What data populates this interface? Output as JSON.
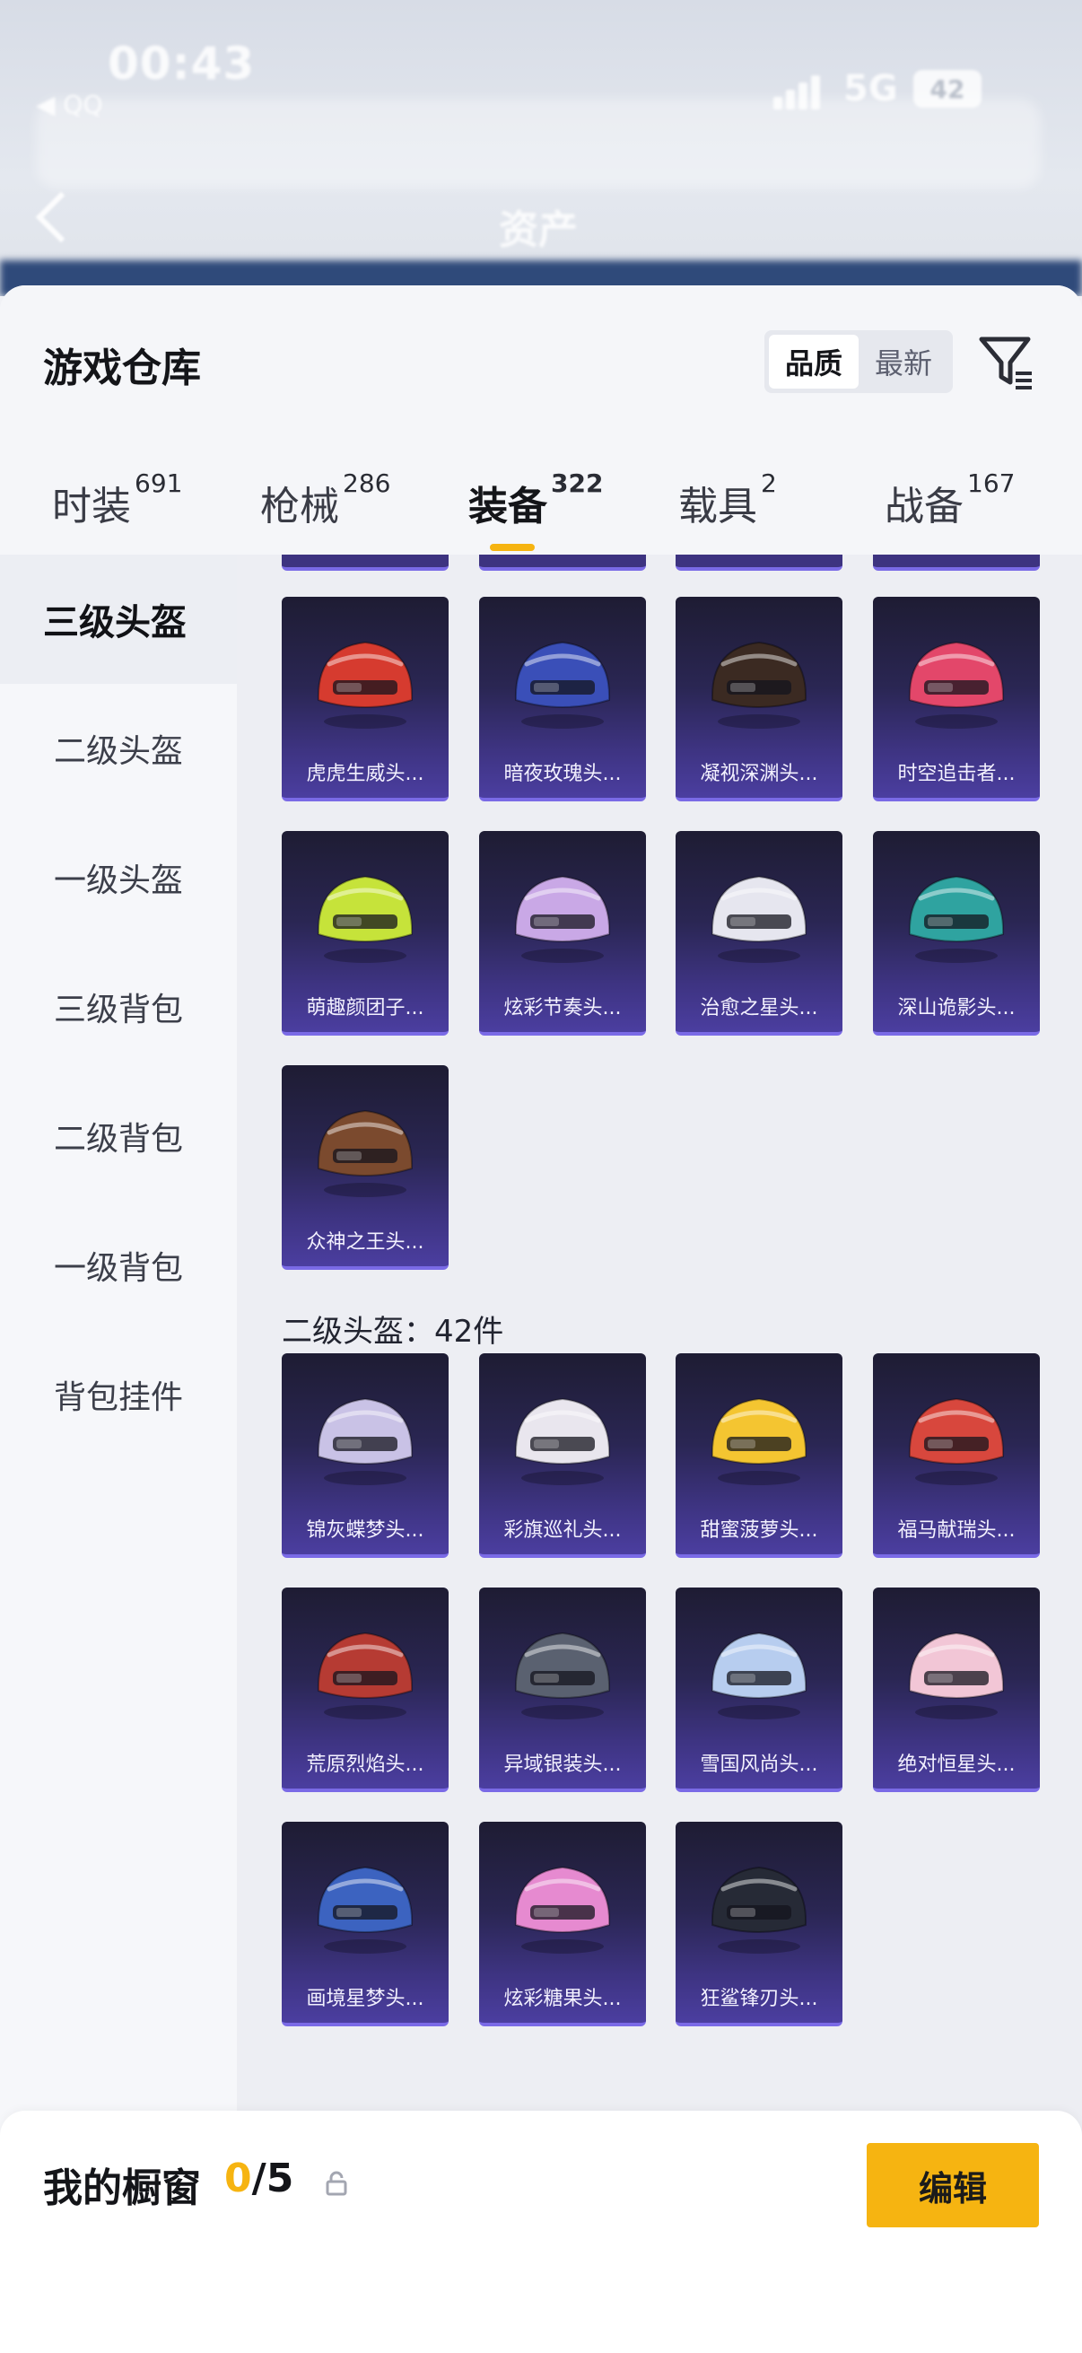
{
  "status": {
    "time": "00:43",
    "back_app": "◀ QQ",
    "network": "5G",
    "battery": "42"
  },
  "background": {
    "title": "资产"
  },
  "header": {
    "title": "游戏仓库",
    "sort_options": [
      "品质",
      "最新"
    ],
    "sort_selected": "品质"
  },
  "tabs": [
    {
      "label": "时装",
      "count": "691"
    },
    {
      "label": "枪械",
      "count": "286"
    },
    {
      "label": "装备",
      "count": "322",
      "active": true
    },
    {
      "label": "载具",
      "count": "2"
    },
    {
      "label": "战备",
      "count": "167"
    }
  ],
  "sidebar": {
    "items": [
      {
        "label": "三级头盔",
        "active": true
      },
      {
        "label": "二级头盔"
      },
      {
        "label": "一级头盔"
      },
      {
        "label": "三级背包"
      },
      {
        "label": "二级背包"
      },
      {
        "label": "一级背包"
      },
      {
        "label": "背包挂件"
      }
    ]
  },
  "level3_items": [
    {
      "name": "虎虎生威头...",
      "icon": "helmet-tiger-icon",
      "color": "#d63b2f"
    },
    {
      "name": "暗夜玫瑰头...",
      "icon": "helmet-rose-icon",
      "color": "#3a4fb8"
    },
    {
      "name": "凝视深渊头...",
      "icon": "helmet-abyss-icon",
      "color": "#3b2a22"
    },
    {
      "name": "时空追击者...",
      "icon": "helmet-mech-icon",
      "color": "#e3476a"
    },
    {
      "name": "萌趣颜团子...",
      "icon": "helmet-sprout-icon",
      "color": "#c6e33a"
    },
    {
      "name": "炫彩节奏头...",
      "icon": "helmet-rhythm-icon",
      "color": "#c9a8e6"
    },
    {
      "name": "治愈之星头...",
      "icon": "helmet-star-icon",
      "color": "#e6e6ef"
    },
    {
      "name": "深山诡影头...",
      "icon": "helmet-shadow-icon",
      "color": "#2fa3a0"
    },
    {
      "name": "众神之王头...",
      "icon": "helmet-god-icon",
      "color": "#7b4a2e"
    }
  ],
  "level2_section": {
    "title": "二级头盔：42件"
  },
  "level2_items": [
    {
      "name": "锦灰蝶梦头...",
      "icon": "helmet-butterfly-icon",
      "color": "#c9c2e6"
    },
    {
      "name": "彩旗巡礼头...",
      "icon": "helmet-flag-icon",
      "color": "#e9e6ee"
    },
    {
      "name": "甜蜜菠萝头...",
      "icon": "helmet-pineapple-icon",
      "color": "#f4c531"
    },
    {
      "name": "福马献瑞头...",
      "icon": "helmet-horse-icon",
      "color": "#d8473d"
    },
    {
      "name": "荒原烈焰头...",
      "icon": "helmet-flame-icon",
      "color": "#b63b33"
    },
    {
      "name": "异域银装头...",
      "icon": "helmet-silver-icon",
      "color": "#5a6170"
    },
    {
      "name": "雪国风尚头...",
      "icon": "helmet-snow-icon",
      "color": "#b7cdef"
    },
    {
      "name": "绝对恒星头...",
      "icon": "helmet-pink-icon",
      "color": "#f2c6d6"
    },
    {
      "name": "画境星梦头...",
      "icon": "helmet-galaxy-icon",
      "color": "#3c63c0"
    },
    {
      "name": "炫彩糖果头...",
      "icon": "helmet-candy-icon",
      "color": "#e68ad0"
    },
    {
      "name": "狂鲨锋刃头...",
      "icon": "helmet-shark-icon",
      "color": "#262a36"
    }
  ],
  "bottom": {
    "showcase_label": "我的橱窗",
    "showcase_current": "0",
    "showcase_total": "/5",
    "edit_label": "编辑"
  },
  "colors": {
    "accent": "#f6b411",
    "card_top": "#1e1c33",
    "card_bottom": "#4b3ea0"
  }
}
